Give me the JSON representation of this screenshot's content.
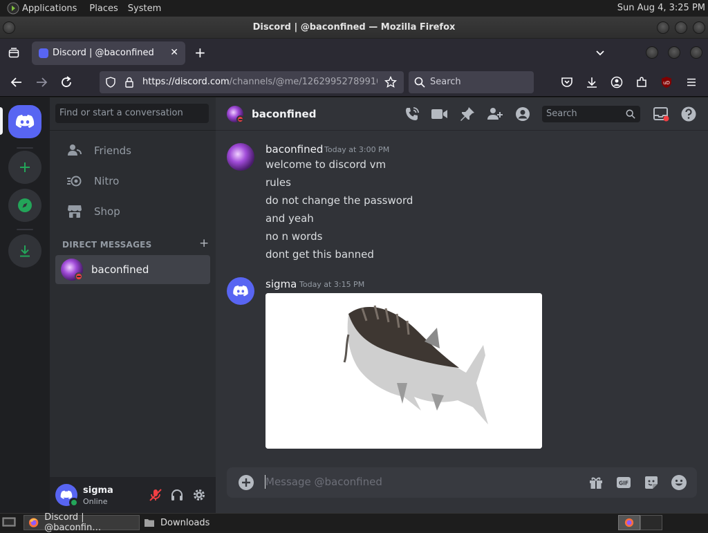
{
  "gnome": {
    "menus": [
      "Applications",
      "Places",
      "System"
    ],
    "clock": "Sun Aug  4,  3:25 PM"
  },
  "window": {
    "title": "Discord | @baconfined — Mozilla Firefox"
  },
  "firefox": {
    "tab_title": "Discord | @baconfined",
    "url_host": "https://discord.com",
    "url_path": "/channels/@me/12629952789910(",
    "search_placeholder": "Search"
  },
  "discord": {
    "dm_search_placeholder": "Find or start a conversation",
    "nav": [
      {
        "label": "Friends",
        "icon": "friends-icon"
      },
      {
        "label": "Nitro",
        "icon": "nitro-icon"
      },
      {
        "label": "Shop",
        "icon": "shop-icon"
      }
    ],
    "dm_header": "DIRECT MESSAGES",
    "dm_list": [
      {
        "name": "baconfined",
        "status": "dnd"
      }
    ],
    "user": {
      "name": "sigma",
      "status": "Online"
    },
    "channel": {
      "name": "baconfined",
      "search_placeholder": "Search"
    },
    "messages": [
      {
        "author": "baconfined",
        "time": "Today at 3:00 PM",
        "lines": [
          "welcome to discord vm",
          "rules",
          "do not change the password",
          "and yeah",
          "no n words",
          "dont get this banned"
        ]
      },
      {
        "author": "sigma",
        "time": "Today at 3:15 PM",
        "lines": [],
        "attachment": "image"
      }
    ],
    "composer_placeholder": "Message @baconfined"
  },
  "taskbar": {
    "items": [
      {
        "label": "Discord | @baconfin…",
        "icon": "firefox-icon"
      },
      {
        "label": "Downloads",
        "icon": "folder-icon"
      }
    ]
  },
  "colors": {
    "blurple": "#5865f2",
    "green": "#23a559",
    "dnd": "#f23f43",
    "bg_chat": "#313338",
    "bg_sidebar": "#2b2d31",
    "bg_guilds": "#1e1f22"
  }
}
